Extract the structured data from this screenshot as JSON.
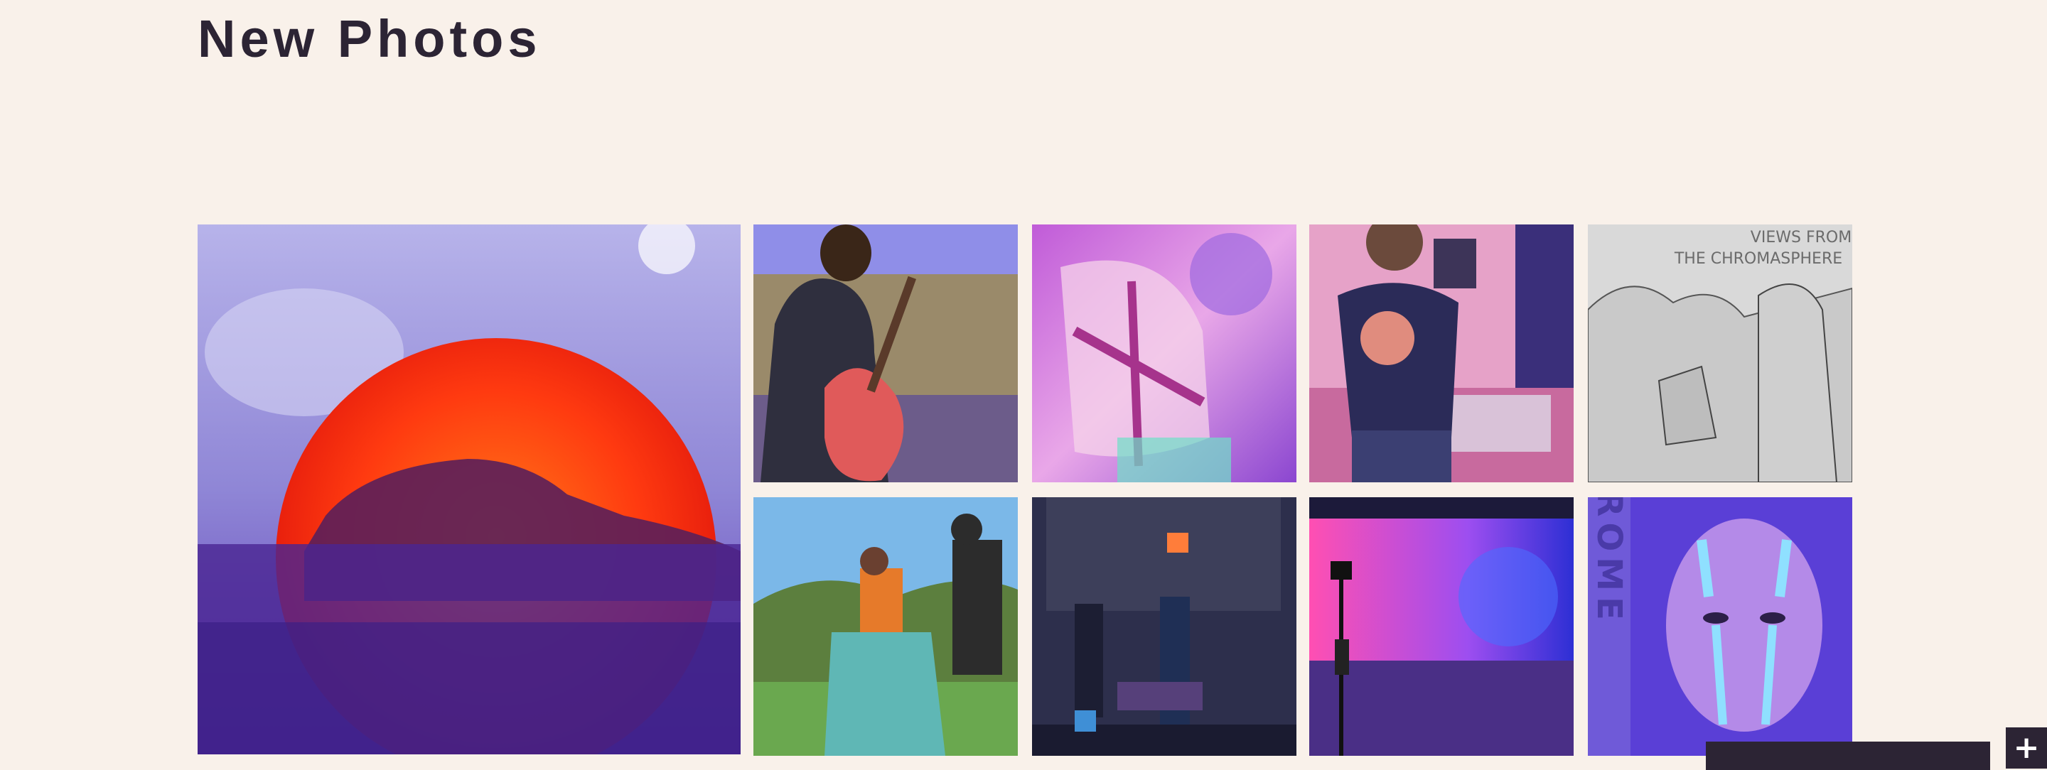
{
  "page": {
    "title": "New Photos"
  },
  "gallery": {
    "photos": [
      {
        "subject": "red sun with car silhouette on starry sky"
      },
      {
        "subject": "man playing guitar on deck"
      },
      {
        "subject": "pink window with clouds"
      },
      {
        "subject": "mirror selfie in bedroom"
      },
      {
        "subject": "illustration poster",
        "text_line_1": "VIEWS FROM",
        "text_line_2": "THE CHROMASPHERE"
      },
      {
        "subject": "outdoor music performance"
      },
      {
        "subject": "dark film set"
      },
      {
        "subject": "pink and blue lit studio"
      },
      {
        "subject": "face with glitter paint",
        "side_text": "CHROME"
      }
    ]
  },
  "actions": {
    "plus_label": "+"
  },
  "colors": {
    "background": "#f9f1ea",
    "title": "#2c2434",
    "bar": "#2c2434"
  },
  "icons": {
    "plus": "plus-icon"
  }
}
